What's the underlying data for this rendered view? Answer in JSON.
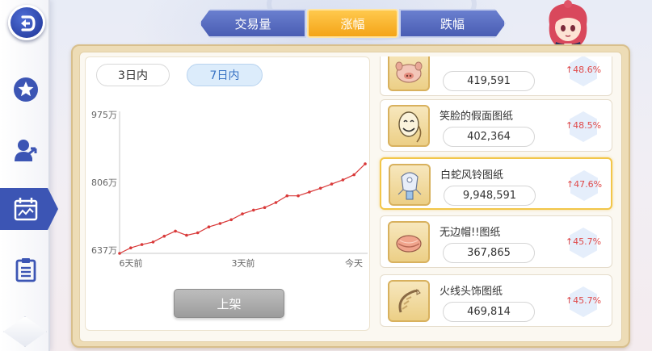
{
  "tabs": [
    {
      "label": "交易量",
      "active": false
    },
    {
      "label": "涨幅",
      "active": true
    },
    {
      "label": "跌幅",
      "active": false
    }
  ],
  "sidebar": {
    "items": [
      {
        "icon": "back-icon"
      },
      {
        "icon": "star-icon"
      },
      {
        "icon": "market-person-icon"
      },
      {
        "icon": "calendar-chart-icon",
        "active": true
      },
      {
        "icon": "clipboard-icon"
      }
    ]
  },
  "period": {
    "options": [
      "3日内",
      "7日内"
    ],
    "selected": "7日内"
  },
  "chart_data": {
    "type": "line",
    "title": "",
    "xlabel": "",
    "ylabel": "",
    "x_ticks": [
      "6天前",
      "3天前",
      "今天"
    ],
    "y_ticks": [
      "975万",
      "806万",
      "637万"
    ],
    "ylim": [
      6370000,
      9750000
    ],
    "series": [
      {
        "color": "#d93a3a",
        "values": [
          6370000,
          6500000,
          6580000,
          6640000,
          6780000,
          6900000,
          6800000,
          6860000,
          7000000,
          7080000,
          7170000,
          7310000,
          7400000,
          7460000,
          7580000,
          7740000,
          7740000,
          7830000,
          7920000,
          8020000,
          8120000,
          8240000,
          8500000
        ]
      }
    ]
  },
  "list_button": "上架",
  "items": [
    {
      "name": "",
      "price": "419,591",
      "change": "48.6%",
      "icon": "pig-face-icon",
      "selected": false
    },
    {
      "name": "笑脸的假面图纸",
      "price": "402,364",
      "change": "48.5%",
      "icon": "smile-mask-icon",
      "selected": false
    },
    {
      "name": "白蛇风铃图纸",
      "price": "9,948,591",
      "change": "47.6%",
      "icon": "wind-chime-icon",
      "selected": true
    },
    {
      "name": "无边帽!!图纸",
      "price": "367,865",
      "change": "45.7%",
      "icon": "beret-icon",
      "selected": false
    },
    {
      "name": "火线头饰图纸",
      "price": "469,814",
      "change": "45.7%",
      "icon": "wire-headgear-icon",
      "selected": false
    }
  ],
  "colors": {
    "accent": "#f4a418",
    "tab_blue": "#4a5db3",
    "rise_red": "#e04848",
    "panel_gold": "#eddcb6"
  }
}
